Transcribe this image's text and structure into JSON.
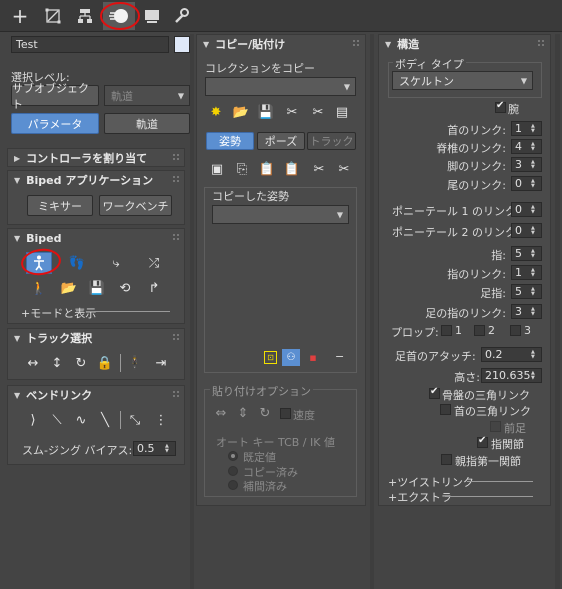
{
  "toolbar": {
    "tabs": [
      {
        "icon": "plus-icon"
      },
      {
        "icon": "curve-editor-icon"
      },
      {
        "icon": "hierarchy-icon"
      },
      {
        "icon": "motion-icon"
      },
      {
        "icon": "display-icon"
      },
      {
        "icon": "wrench-icon"
      }
    ]
  },
  "left": {
    "name_value": "Test",
    "selection_level_label": "選択レベル:",
    "subobject_button": "サブオブジェクト",
    "trajectory_dropdown": "軌道",
    "parameter_button": "パラメータ",
    "trajectory_button": "軌道",
    "controller_assign_title": "コントローラを割り当て",
    "biped_apps_title": "Biped アプリケーション",
    "mixer_button": "ミキサー",
    "workbench_button": "ワークベンチ",
    "biped_title": "Biped",
    "mode_display_label": "+モードと表示",
    "track_select_title": "トラック選択",
    "bend_link_title": "ベンドリンク",
    "smoothing_bias_label": "スム-ジング バイアス:",
    "smoothing_bias_value": "0.5"
  },
  "middle": {
    "title": "コピー/貼付け",
    "copy_collection_label": "コレクションをコピー",
    "collection_value": "",
    "tab_posture": "姿勢",
    "tab_pose": "ポーズ",
    "tab_track": "トラック",
    "copied_posture_label": "コピーした姿勢",
    "copied_posture_value": "",
    "paste_options_label": "貼り付けオプション",
    "speed_label": "速度",
    "auto_key_label": "オート キー TCB / IK 値",
    "radio_default": "既定値",
    "radio_copied": "コピー済み",
    "radio_interp": "補間済み",
    "minus_label": "−"
  },
  "right": {
    "title": "構造",
    "body_type_label": "ボディ タイプ",
    "body_type_value": "スケルトン",
    "arm_label": "腕",
    "neck_links_label": "首のリンク:",
    "neck_links_value": "1",
    "spine_links_label": "脊椎のリンク:",
    "spine_links_value": "4",
    "leg_links_label": "脚のリンク:",
    "leg_links_value": "3",
    "tail_links_label": "尾のリンク:",
    "tail_links_value": "0",
    "ponytail1_label": "ポニーテール 1 のリンク:",
    "ponytail1_value": "0",
    "ponytail2_label": "ポニーテール 2 のリンク:",
    "ponytail2_value": "0",
    "fingers_label": "指:",
    "fingers_value": "5",
    "finger_links_label": "指のリンク:",
    "finger_links_value": "1",
    "toes_label": "足指:",
    "toes_value": "5",
    "toe_links_label": "足の指のリンク:",
    "toe_links_value": "3",
    "props_label": "プロップ:",
    "prop1": "1",
    "prop2": "2",
    "prop3": "3",
    "ankle_attach_label": "足首のアタッチ:",
    "ankle_attach_value": "0.2",
    "height_label": "高さ:",
    "height_value": "210.635",
    "pelvis_tri_label": "骨盤の三角リンク",
    "neck_tri_label": "首の三角リンク",
    "forefoot_label": "前足",
    "knuckles_label": "指関節",
    "short_thumb_label": "親指第一関節",
    "twist_links_label": "+ツイストリンク",
    "extra_label": "+エクストラ"
  }
}
